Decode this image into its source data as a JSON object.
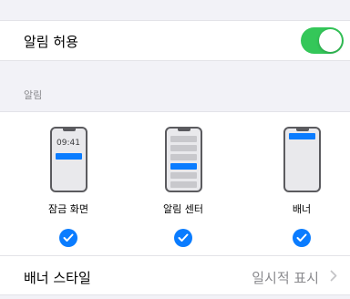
{
  "allow_notifications": {
    "label": "알림 허용",
    "enabled": true
  },
  "alerts_section": {
    "header": "알림",
    "options": [
      {
        "label": "잠금 화면",
        "time": "09:41",
        "checked": true
      },
      {
        "label": "알림 센터",
        "checked": true
      },
      {
        "label": "배너",
        "checked": true
      }
    ]
  },
  "banner_style": {
    "label": "배너 스타일",
    "value": "일시적 표시"
  },
  "colors": {
    "accent": "#0a7cff",
    "toggle_on": "#34c759"
  },
  "icons": [
    "toggle-switch",
    "check-circle-icon",
    "chevron-right-icon"
  ]
}
